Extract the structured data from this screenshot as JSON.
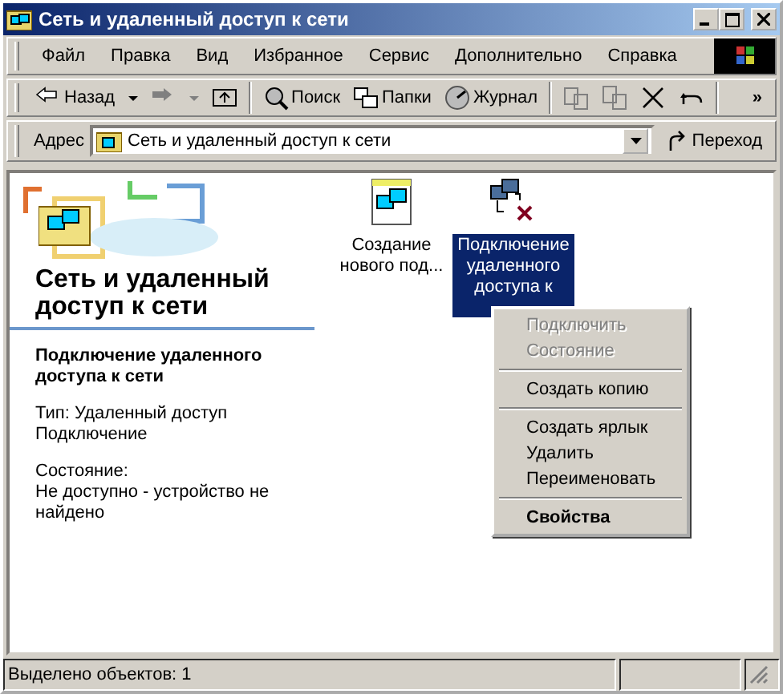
{
  "window": {
    "title": "Сеть и удаленный доступ к сети"
  },
  "menu_bar": [
    "Файл",
    "Правка",
    "Вид",
    "Избранное",
    "Сервис",
    "Дополнительно",
    "Справка"
  ],
  "toolbar": [
    {
      "kind": "back",
      "label": "Назад",
      "disabled": false
    },
    {
      "kind": "forward",
      "disabled": true
    },
    {
      "kind": "up",
      "disabled": false
    },
    {
      "kind": "search",
      "label": "Поиск",
      "disabled": false
    },
    {
      "kind": "folders",
      "label": "Папки",
      "disabled": false
    },
    {
      "kind": "history",
      "label": "Журнал",
      "disabled": false
    },
    {
      "kind": "move",
      "disabled": true
    },
    {
      "kind": "copy",
      "disabled": true
    },
    {
      "kind": "delete",
      "disabled": false
    },
    {
      "kind": "undo",
      "disabled": false
    },
    {
      "kind": "more",
      "label": "»",
      "disabled": false
    }
  ],
  "address_bar": {
    "label": "Адрес",
    "value": "Сеть и удаленный доступ к сети",
    "go": "Переход"
  },
  "info_panel": {
    "title": "Сеть и удаленный доступ к сети",
    "item_title": "Подключение удаленного доступа к сети",
    "type": "Тип: Удаленный доступ Подключение",
    "status_label": "Состояние:",
    "status": "Не доступно - устройство не найдено"
  },
  "icons": [
    {
      "kind": "wizard",
      "label": "Создание нового под...",
      "selected": false
    },
    {
      "kind": "dialup",
      "label": "Подключение удаленного доступа к",
      "selected": true
    }
  ],
  "context_menu": [
    {
      "kind": "item",
      "label": "Подключить",
      "disabled": true,
      "default": false
    },
    {
      "kind": "item",
      "label": "Состояние",
      "disabled": true,
      "default": false
    },
    {
      "kind": "separator"
    },
    {
      "kind": "item",
      "label": "Создать копию",
      "disabled": false,
      "default": false
    },
    {
      "kind": "separator"
    },
    {
      "kind": "item",
      "label": "Создать ярлык",
      "disabled": false,
      "default": false
    },
    {
      "kind": "item",
      "label": "Удалить",
      "disabled": false,
      "default": false
    },
    {
      "kind": "item",
      "label": "Переименовать",
      "disabled": false,
      "default": false
    },
    {
      "kind": "separator"
    },
    {
      "kind": "item",
      "label": "Свойства",
      "disabled": false,
      "default": true
    }
  ],
  "status_bar": {
    "text": "Выделено объектов: 1"
  }
}
